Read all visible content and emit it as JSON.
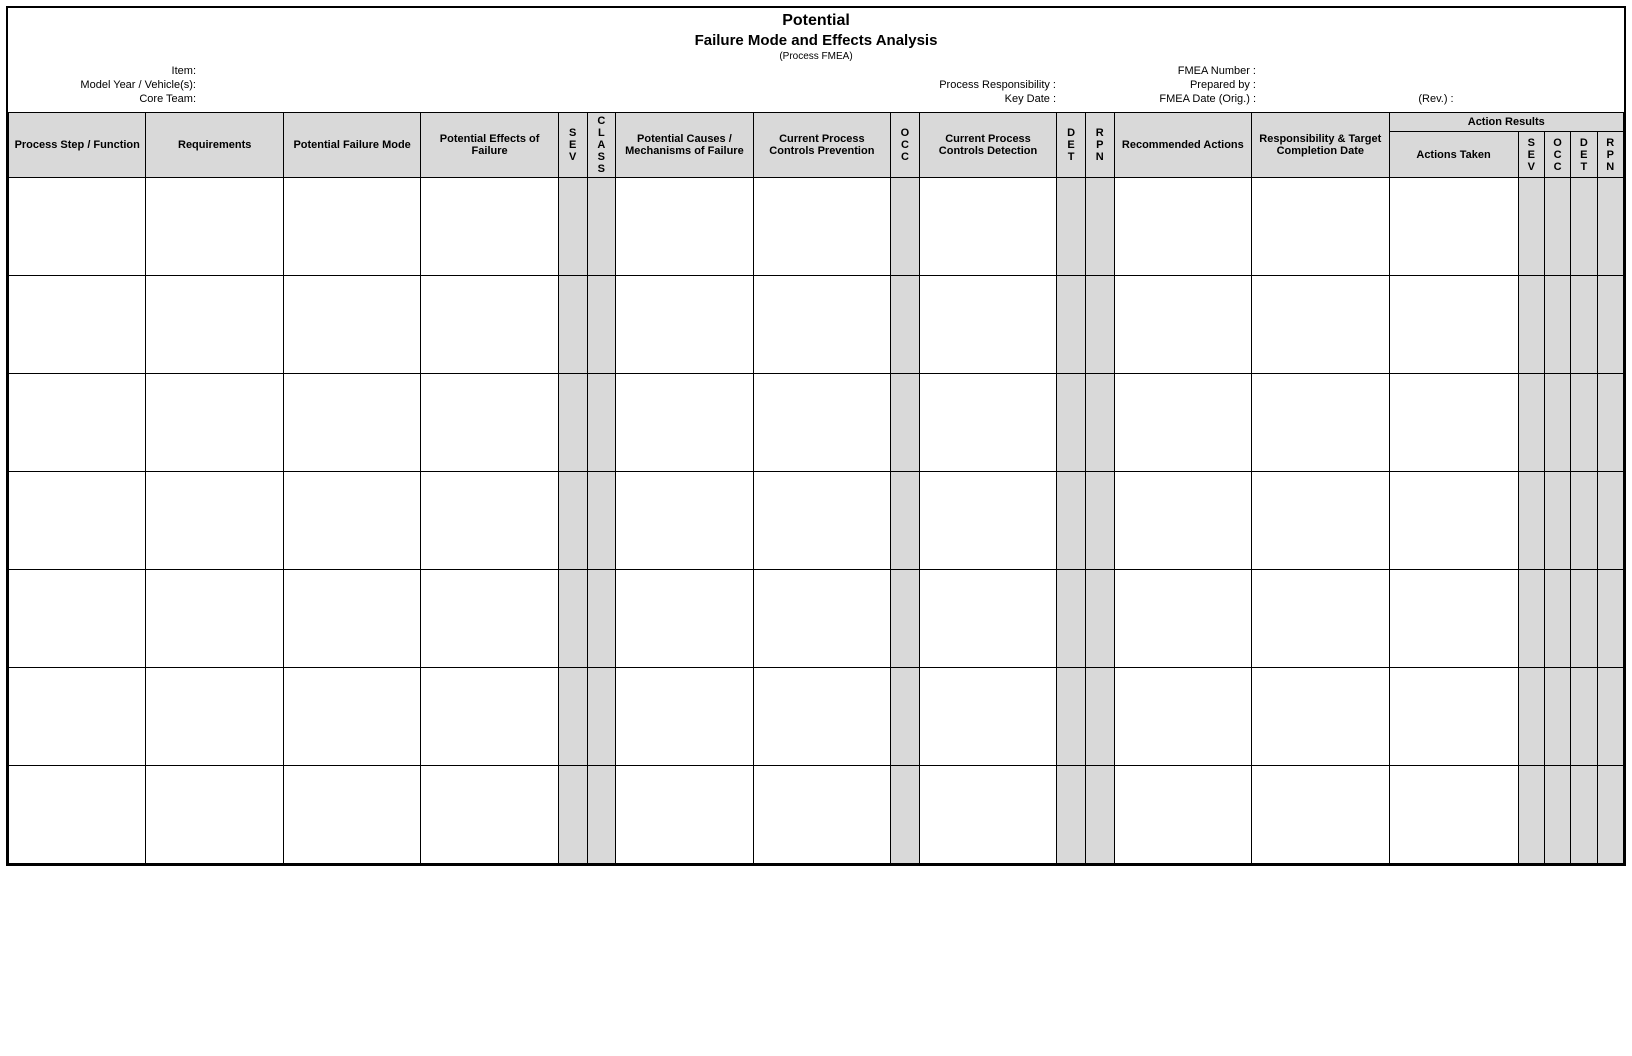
{
  "title": {
    "line1": "Potential",
    "line2": "Failure Mode and Effects Analysis",
    "line3": "(Process FMEA)"
  },
  "meta": {
    "col1": {
      "item": "Item:",
      "model": "Model Year / Vehicle(s):",
      "team": "Core Team:"
    },
    "col2": {
      "resp": "Process Responsibility :",
      "key": "Key Date :"
    },
    "col3": {
      "num": "FMEA Number :",
      "prep": "Prepared by :",
      "date": "FMEA Date (Orig.) :"
    },
    "col4": {
      "rev": "(Rev.) :"
    }
  },
  "headers": {
    "process_step": "Process Step / Function",
    "requirements": "Requirements",
    "pfm": "Potential Failure Mode",
    "pef": "Potential Effects of Failure",
    "sev": "S\nE\nV",
    "class": "C\nL\nA\nS\nS",
    "causes": "Potential Causes / Mechanisms of Failure",
    "prevention": "Current Process Controls Prevention",
    "occ": "O\nC\nC",
    "detection": "Current Process Controls Detection",
    "det": "D\nE\nT",
    "rpn": "R\nP\nN",
    "rec": "Recommended Actions",
    "resp_date": "Responsibility & Target Completion Date",
    "action_results": "Action Results",
    "actions_taken": "Actions Taken",
    "sev2": "S\nE\nV",
    "occ2": "O\nC\nC",
    "det2": "D\nE\nT",
    "rpn2": "R\nP\nN"
  },
  "rows": 7
}
